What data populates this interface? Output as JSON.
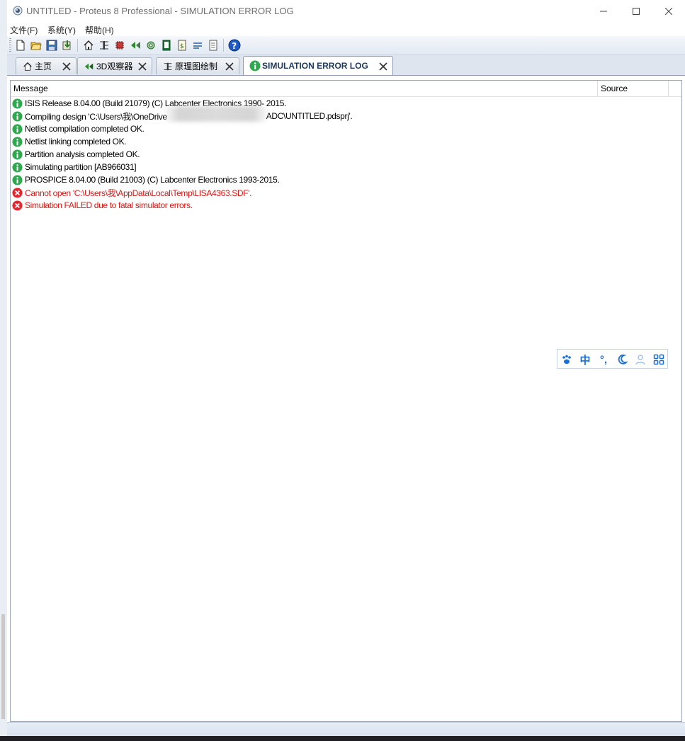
{
  "window": {
    "title": "UNTITLED - Proteus 8 Professional - SIMULATION ERROR LOG"
  },
  "menu": {
    "items": [
      "文件(F)",
      "系统(Y)",
      "帮助(H)"
    ]
  },
  "toolbar": {
    "buttons": [
      "new-file-icon",
      "open-folder-icon",
      "save-icon",
      "import-icon",
      "home-icon",
      "schematic-icon",
      "pcb-chip-icon",
      "3d-viewer-icon",
      "gerber-icon",
      "bill-of-materials-icon",
      "design-explorer-icon",
      "netlist-icon",
      "notes-icon",
      "help-icon"
    ]
  },
  "tabs": [
    {
      "label": "主页",
      "icon": "home-icon"
    },
    {
      "label": "3D观察器",
      "icon": "3d-viewer-icon"
    },
    {
      "label": "原理图绘制",
      "icon": "schematic-icon"
    },
    {
      "label": "SIMULATION ERROR LOG",
      "icon": "info-icon",
      "active": true
    }
  ],
  "log": {
    "columns": [
      "Message",
      "Source"
    ],
    "rows": [
      {
        "type": "info",
        "message": "ISIS Release 8.04.00 (Build 21079) (C) Labcenter Electronics 1990- 2015."
      },
      {
        "type": "info",
        "message": "Compiling design 'C:\\Users\\我\\OneDrive",
        "message_tail": "ADC\\UNTITLED.pdsprj'."
      },
      {
        "type": "info",
        "message": "Netlist compilation completed OK."
      },
      {
        "type": "info",
        "message": "Netlist linking completed OK."
      },
      {
        "type": "info",
        "message": "Partition analysis completed OK."
      },
      {
        "type": "info",
        "message": "Simulating partition [AB966031]"
      },
      {
        "type": "info",
        "message": "PROSPICE 8.04.00 (Build 21003) (C) Labcenter Electronics 1993-2015."
      },
      {
        "type": "error",
        "message": "Cannot open 'C:\\Users\\我\\AppData\\Local\\Temp\\LISA4363.SDF'."
      },
      {
        "type": "error",
        "message": "Simulation FAILED due to fatal simulator errors."
      }
    ]
  },
  "ime": {
    "items": [
      "paw-icon",
      "中",
      "°,",
      "moon-icon",
      "user-icon",
      "grid-icon"
    ]
  },
  "colors": {
    "info": "#2fa84f",
    "error": "#d81818",
    "accent": "#1a6fd6"
  }
}
